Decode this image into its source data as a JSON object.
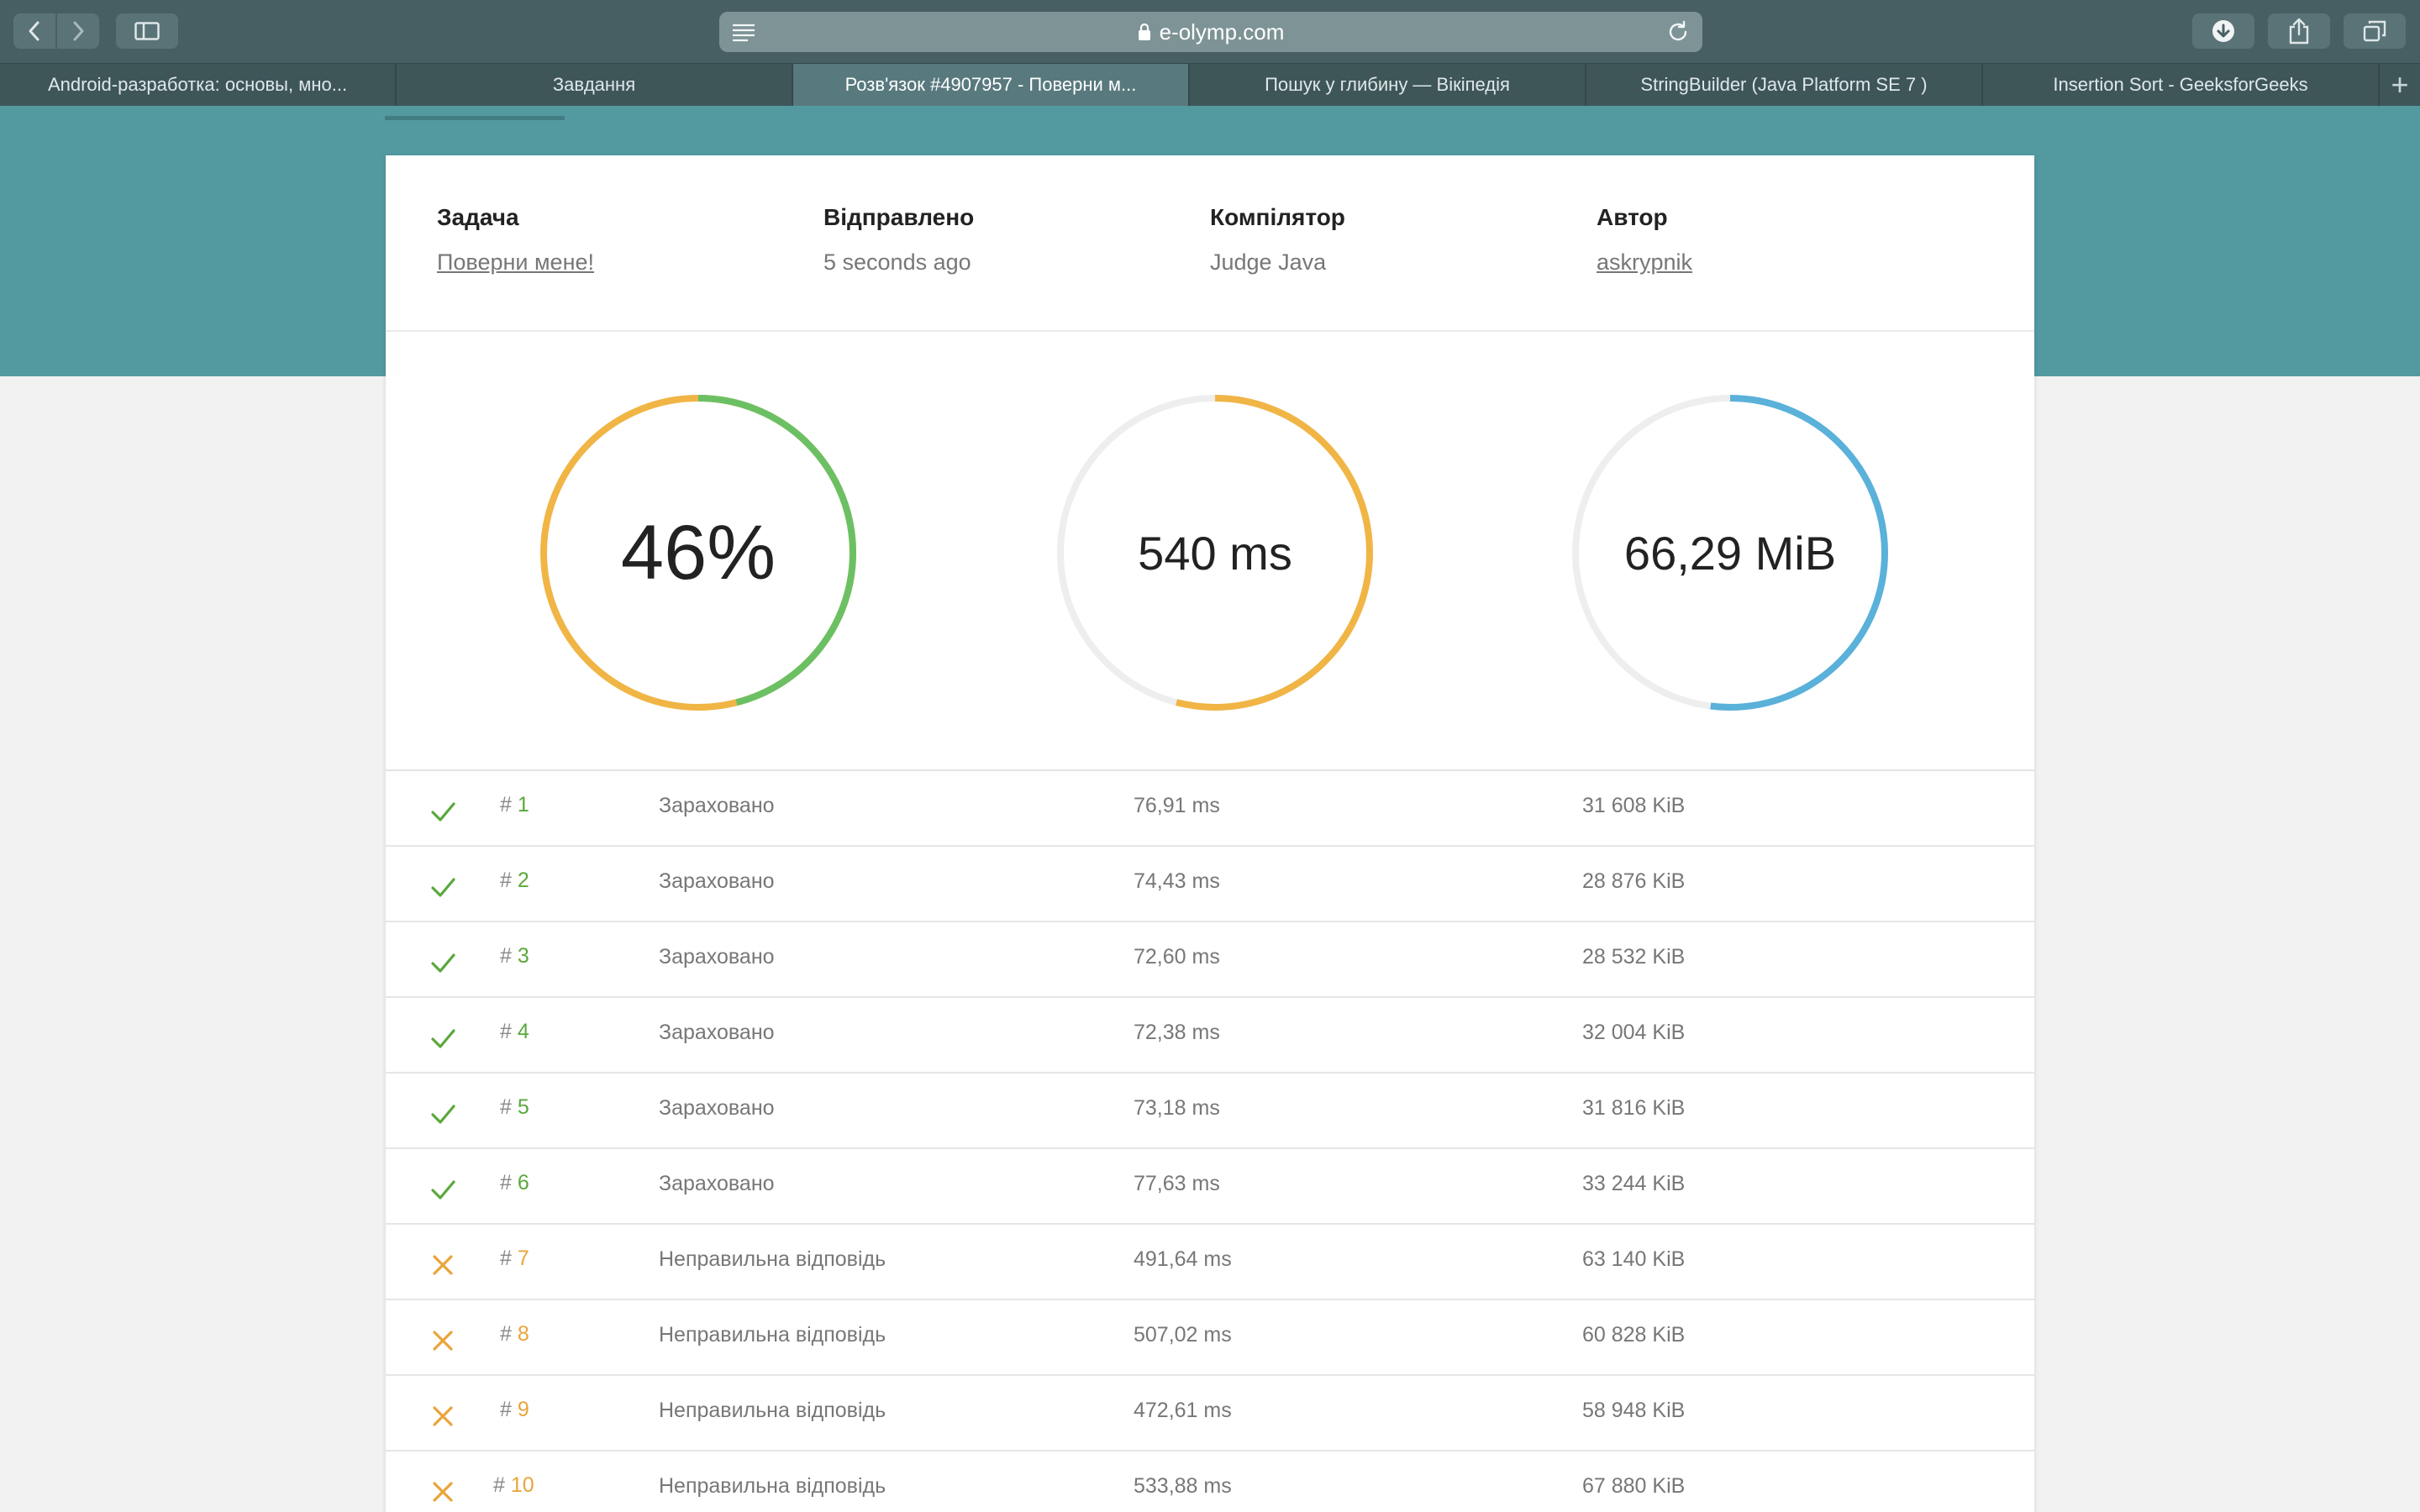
{
  "browser": {
    "url": "e-olymp.com",
    "tabs": [
      {
        "label": "Android-разработка: основы, мно...",
        "active": false
      },
      {
        "label": "Завдання",
        "active": false
      },
      {
        "label": "Розв'язок #4907957 - Поверни м...",
        "active": true
      },
      {
        "label": "Пошук у глибину — Вікіпедія",
        "active": false
      },
      {
        "label": "StringBuilder (Java Platform SE 7 )",
        "active": false
      },
      {
        "label": "Insertion Sort - GeeksforGeeks",
        "active": false
      }
    ],
    "new_tab": "+"
  },
  "submission": {
    "problem_label": "Задача",
    "problem_value": "Поверни мене!",
    "sent_label": "Відправлено",
    "sent_value": "5 seconds ago",
    "compiler_label": "Компілятор",
    "compiler_value": "Judge Java",
    "author_label": "Автор",
    "author_value": "askrypnik"
  },
  "gauges": {
    "score": {
      "text": "46%",
      "fraction": 0.46,
      "color": "#f0b545",
      "fill_color": "#6cc064"
    },
    "time": {
      "text": "540 ms",
      "fraction": 0.54,
      "color": "#f0b545",
      "track_color": "#eeeeee"
    },
    "memory": {
      "text": "66,29 MiB",
      "fraction": 0.52,
      "color": "#5ab1da",
      "track_color": "#eeeeee"
    }
  },
  "colors": {
    "accepted": "#5aa83c",
    "wrong": "#e9a43a"
  },
  "tests": [
    {
      "num": "1",
      "status": "accepted",
      "verdict": "Зараховано",
      "time": "76,91 ms",
      "memory": "31 608 KiB"
    },
    {
      "num": "2",
      "status": "accepted",
      "verdict": "Зараховано",
      "time": "74,43 ms",
      "memory": "28 876 KiB"
    },
    {
      "num": "3",
      "status": "accepted",
      "verdict": "Зараховано",
      "time": "72,60 ms",
      "memory": "28 532 KiB"
    },
    {
      "num": "4",
      "status": "accepted",
      "verdict": "Зараховано",
      "time": "72,38 ms",
      "memory": "32 004 KiB"
    },
    {
      "num": "5",
      "status": "accepted",
      "verdict": "Зараховано",
      "time": "73,18 ms",
      "memory": "31 816 KiB"
    },
    {
      "num": "6",
      "status": "accepted",
      "verdict": "Зараховано",
      "time": "77,63 ms",
      "memory": "33 244 KiB"
    },
    {
      "num": "7",
      "status": "wrong",
      "verdict": "Неправильна відповідь",
      "time": "491,64 ms",
      "memory": "63 140 KiB"
    },
    {
      "num": "8",
      "status": "wrong",
      "verdict": "Неправильна відповідь",
      "time": "507,02 ms",
      "memory": "60 828 KiB"
    },
    {
      "num": "9",
      "status": "wrong",
      "verdict": "Неправильна відповідь",
      "time": "472,61 ms",
      "memory": "58 948 KiB"
    },
    {
      "num": "10",
      "status": "wrong",
      "verdict": "Неправильна відповідь",
      "time": "533,88 ms",
      "memory": "67 880 KiB"
    }
  ]
}
